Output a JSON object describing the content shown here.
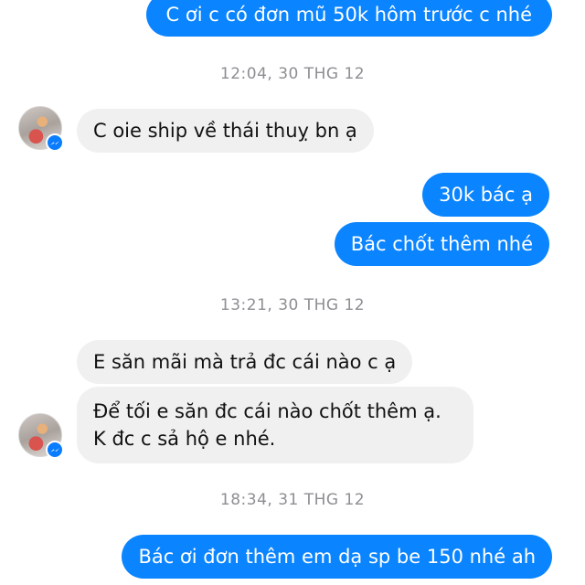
{
  "messages": {
    "m1": "C ơi c có đơn mũ 50k hôm trước c nhé",
    "ts1": "12:04, 30 THG 12",
    "m2": "C oie ship về thái thuỵ bn ạ",
    "m3": "30k bác ạ",
    "m4": "Bác chốt thêm nhé",
    "ts2": "13:21, 30 THG 12",
    "m5": "E săn mãi mà trả đc cái nào c ạ",
    "m6": "Để tối e săn đc cái nào chốt thêm ạ. K đc c sả hộ e nhé.",
    "ts3": "18:34, 31 THG 12",
    "m7": "Bác ơi đơn thêm em dạ sp be 150 nhé ah"
  },
  "colors": {
    "outgoing": "#0a84ff",
    "incoming": "#f1f0f0",
    "timestamp": "#8e8e93"
  },
  "icons": {
    "badge": "messenger-icon"
  }
}
